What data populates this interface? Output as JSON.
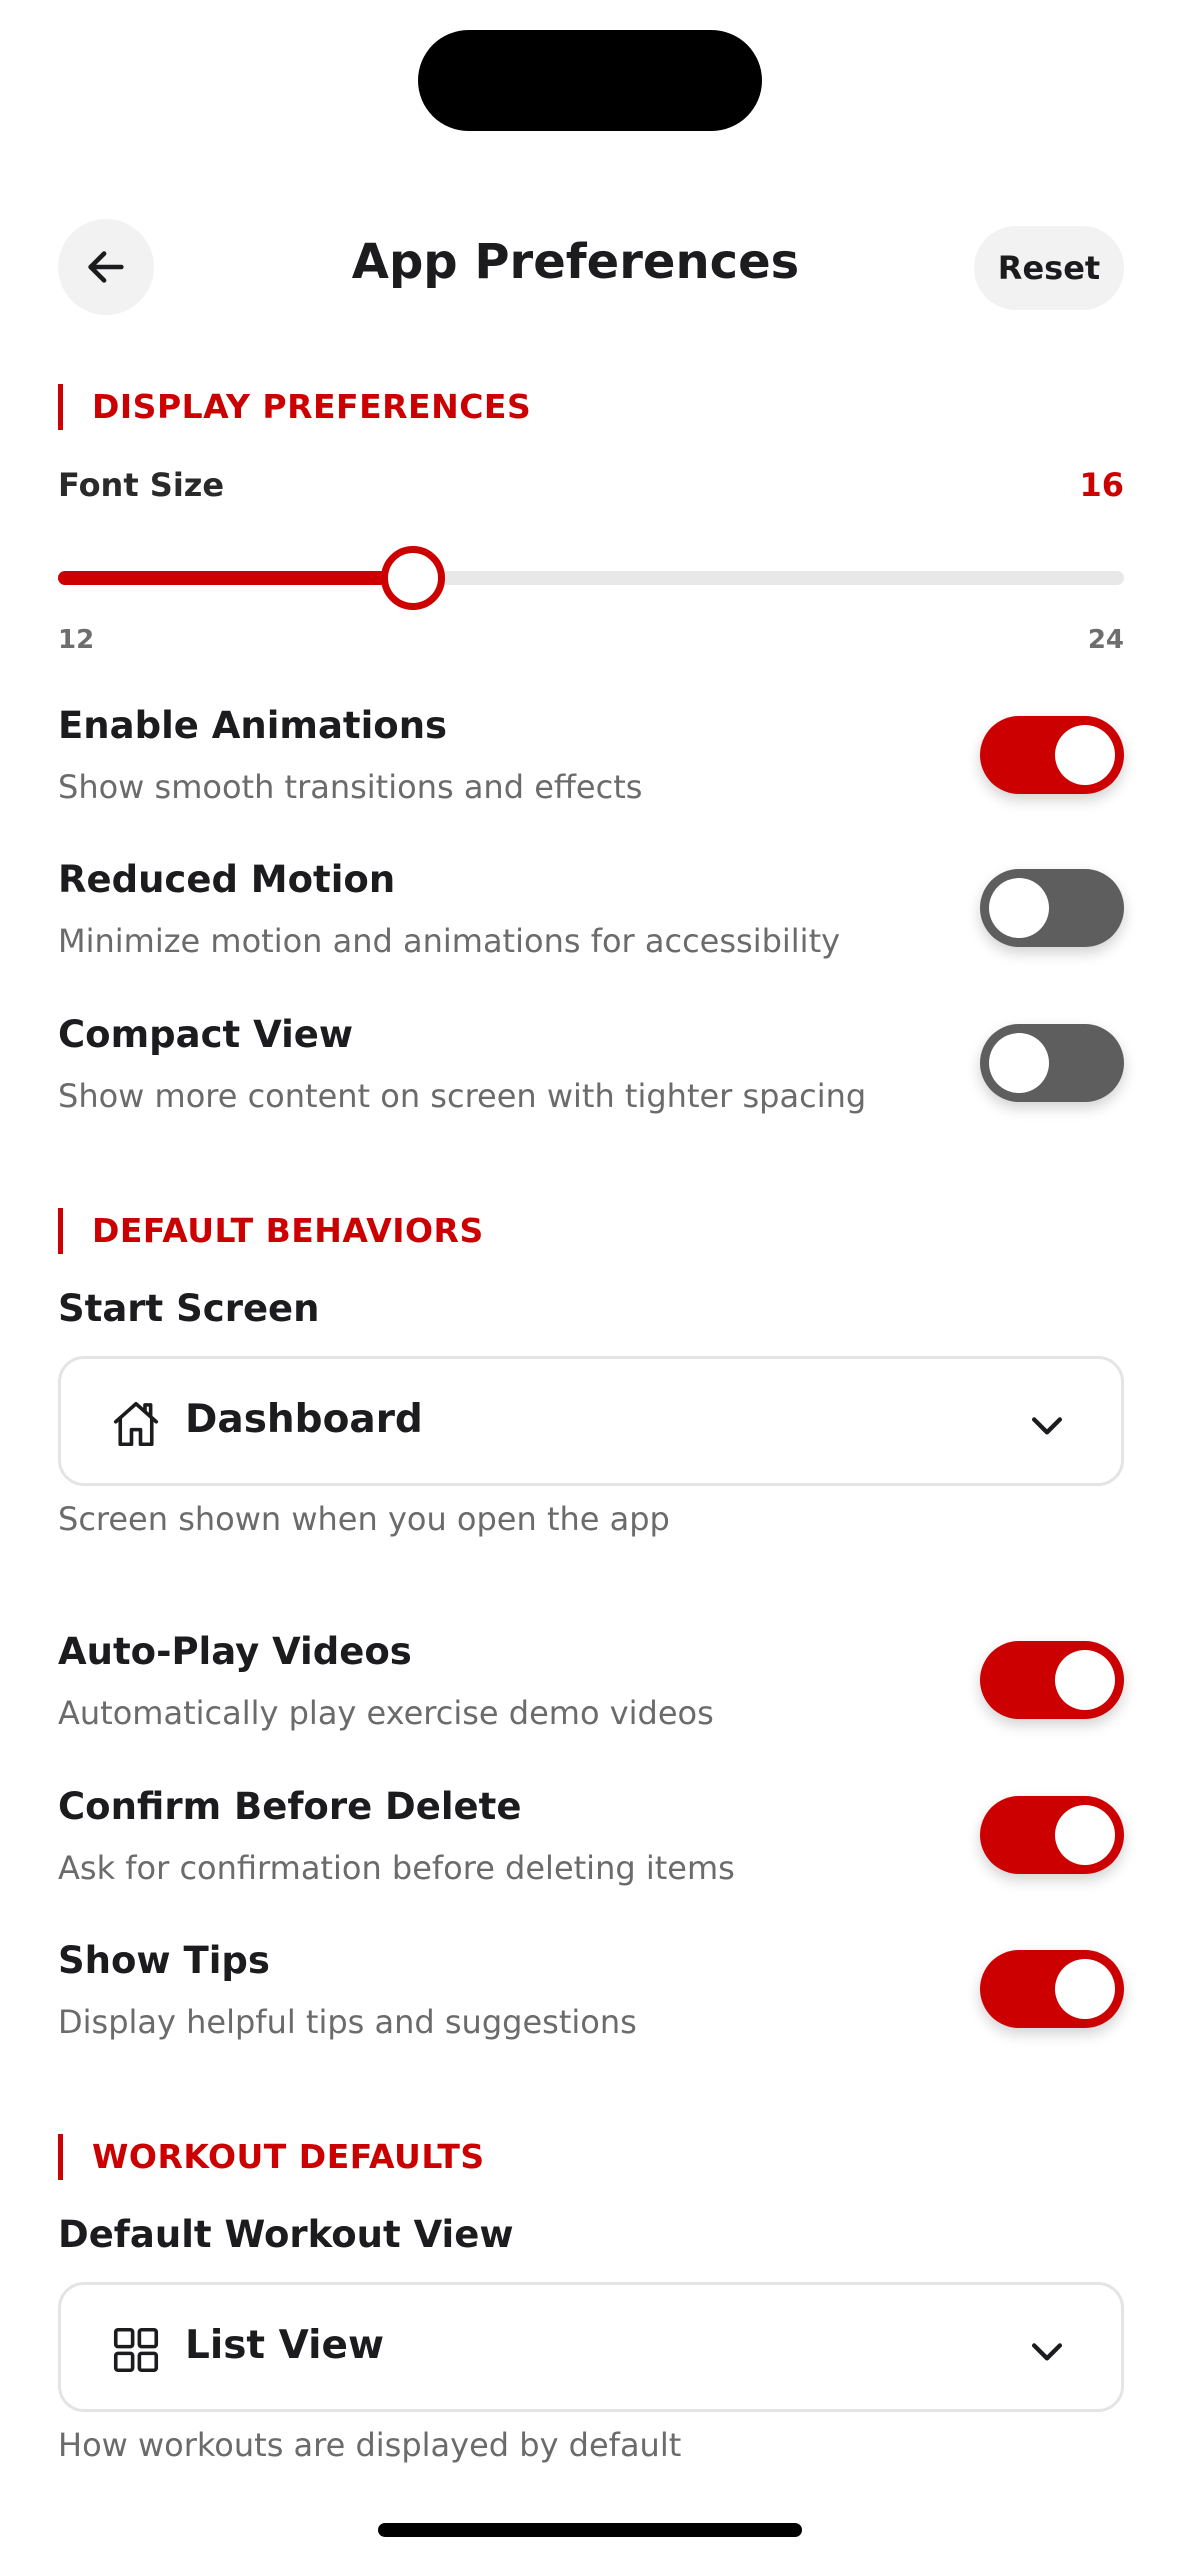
{
  "header": {
    "title": "App Preferences",
    "reset_label": "Reset",
    "back_icon": "arrow-left-icon"
  },
  "display": {
    "section_title": "DISPLAY PREFERENCES",
    "font_size": {
      "label": "Font Size",
      "value": 16,
      "value_text": "16",
      "min": 12,
      "max": 24,
      "min_text": "12",
      "max_text": "24"
    },
    "enable_animations": {
      "title": "Enable Animations",
      "desc": "Show smooth transitions and effects",
      "on": true
    },
    "reduced_motion": {
      "title": "Reduced Motion",
      "desc": "Minimize motion and animations for accessibility",
      "on": false
    },
    "compact_view": {
      "title": "Compact View",
      "desc": "Show more content on screen with tighter spacing",
      "on": false
    }
  },
  "behaviors": {
    "section_title": "DEFAULT BEHAVIORS",
    "start_screen": {
      "label": "Start Screen",
      "value": "Dashboard",
      "icon": "home-icon",
      "helper": "Screen shown when you open the app"
    },
    "auto_play": {
      "title": "Auto-Play Videos",
      "desc": "Automatically play exercise demo videos",
      "on": true
    },
    "confirm_delete": {
      "title": "Confirm Before Delete",
      "desc": "Ask for confirmation before deleting items",
      "on": true
    },
    "show_tips": {
      "title": "Show Tips",
      "desc": "Display helpful tips and suggestions",
      "on": true
    }
  },
  "workout": {
    "section_title": "WORKOUT DEFAULTS",
    "default_view": {
      "label": "Default Workout View",
      "value": "List View",
      "icon": "grid-icon",
      "helper": "How workouts are displayed by default"
    }
  },
  "colors": {
    "accent": "#cc0000",
    "toggle_off": "#5e5e5e",
    "track": "#e8e8e8"
  }
}
